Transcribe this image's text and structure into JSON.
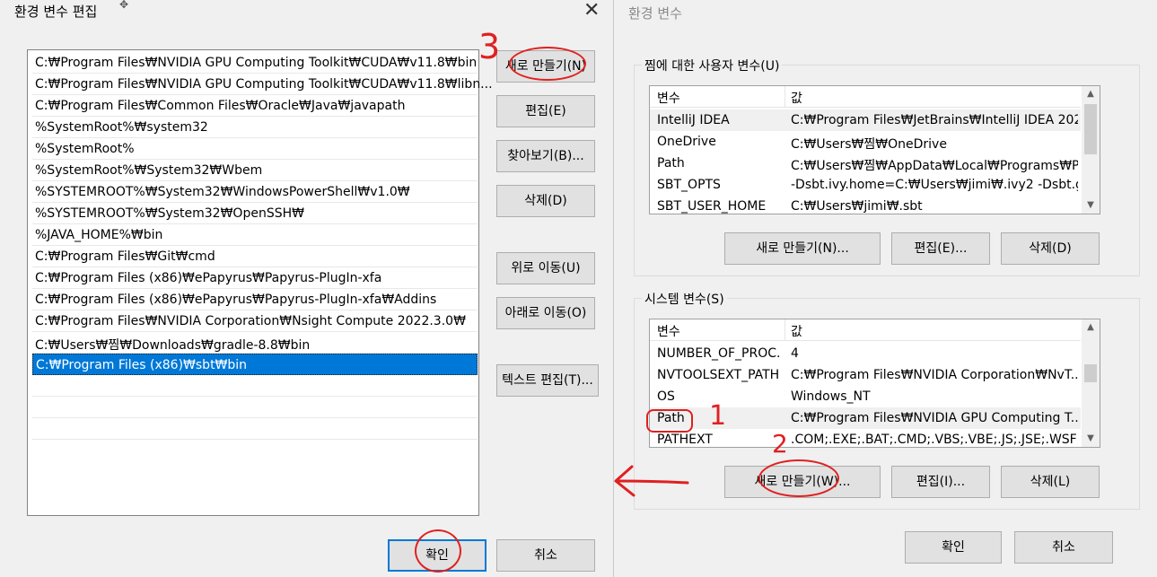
{
  "env": {
    "title": "환경 변수",
    "user_group_label": "찜에 대한 사용자 변수(U)",
    "system_group_label": "시스템 변수(S)",
    "header_var": "변수",
    "header_val": "값",
    "user_rows": [
      {
        "name": "IntelliJ IDEA",
        "value": "C:₩Program Files₩JetBrains₩IntelliJ IDEA 202..."
      },
      {
        "name": "OneDrive",
        "value": "C:₩Users₩찜₩OneDrive"
      },
      {
        "name": "Path",
        "value": "C:₩Users₩찜₩AppData₩Local₩Programs₩Py..."
      },
      {
        "name": "SBT_OPTS",
        "value": "-Dsbt.ivy.home=C:₩Users₩jimi₩.ivy2 -Dsbt.gl..."
      },
      {
        "name": "SBT_USER_HOME",
        "value": "C:₩Users₩jimi₩.sbt"
      }
    ],
    "system_rows": [
      {
        "name": "NUMBER_OF_PROC...",
        "value": "4"
      },
      {
        "name": "NVTOOLSEXT_PATH",
        "value": "C:₩Program Files₩NVIDIA Corporation₩NvT..."
      },
      {
        "name": "OS",
        "value": "Windows_NT"
      },
      {
        "name": "Path",
        "value": "C:₩Program Files₩NVIDIA GPU Computing T..."
      },
      {
        "name": "PATHEXT",
        "value": ".COM;.EXE;.BAT;.CMD;.VBS;.VBE;.JS;.JSE;.WSF;..."
      }
    ],
    "user_buttons": {
      "new": "새로 만들기(N)...",
      "edit": "편집(E)...",
      "delete": "삭제(D)"
    },
    "system_buttons": {
      "new": "새로 만들기(W)...",
      "edit": "편집(I)...",
      "delete": "삭제(L)"
    },
    "ok": "확인",
    "cancel": "취소"
  },
  "edit": {
    "title": "환경 변수 편집",
    "close_glyph": "✕",
    "paths": [
      "C:₩Program Files₩NVIDIA GPU Computing Toolkit₩CUDA₩v11.8₩bin",
      "C:₩Program Files₩NVIDIA GPU Computing Toolkit₩CUDA₩v11.8₩libn...",
      "C:₩Program Files₩Common Files₩Oracle₩Java₩javapath",
      "%SystemRoot%₩system32",
      "%SystemRoot%",
      "%SystemRoot%₩System32₩Wbem",
      "%SYSTEMROOT%₩System32₩WindowsPowerShell₩v1.0₩",
      "%SYSTEMROOT%₩System32₩OpenSSH₩",
      "%JAVA_HOME%₩bin",
      "C:₩Program Files₩Git₩cmd",
      "C:₩Program Files (x86)₩ePapyrus₩Papyrus-PlugIn-xfa",
      "C:₩Program Files (x86)₩ePapyrus₩Papyrus-PlugIn-xfa₩Addins",
      "C:₩Program Files₩NVIDIA Corporation₩Nsight Compute 2022.3.0₩",
      "C:₩Users₩찜₩Downloads₩gradle-8.8₩bin",
      "C:₩Program Files (x86)₩sbt₩bin"
    ],
    "buttons": {
      "new": "새로 만들기(N)",
      "edit": "편집(E)",
      "browse": "찾아보기(B)...",
      "delete": "삭제(D)",
      "move_up": "위로 이동(U)",
      "move_down": "아래로 이동(O)",
      "text_edit": "텍스트 편집(T)..."
    },
    "ok": "확인",
    "cancel": "취소"
  },
  "annotations": {
    "step1": "1",
    "step2": "2",
    "step3": "3"
  },
  "colors": {
    "selection": "#0078d7",
    "annotation": "#e02020"
  }
}
